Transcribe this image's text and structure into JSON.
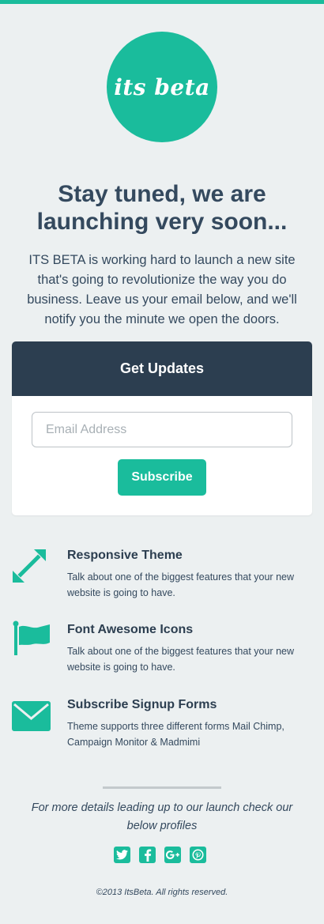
{
  "logo": {
    "text": "its beta"
  },
  "headline": "Stay tuned, we are launching very soon...",
  "intro": "ITS BETA is working hard to launch a new site that's going to revolutionize the way you do business. Leave us your email below, and we'll notify you the minute we open the doors.",
  "signup": {
    "header": "Get Updates",
    "email_placeholder": "Email Address",
    "subscribe_label": "Subscribe"
  },
  "features": [
    {
      "icon": "expand-arrows-icon",
      "title": "Responsive Theme",
      "desc": "Talk about one of the biggest features that your new website is going to have."
    },
    {
      "icon": "flag-icon",
      "title": "Font Awesome Icons",
      "desc": "Talk about one of the biggest features that your new website is going to have."
    },
    {
      "icon": "envelope-icon",
      "title": "Subscribe Signup Forms",
      "desc": "Theme supports three different forms Mail Chimp, Campaign Monitor & Madmimi"
    }
  ],
  "outro": "For more details leading up to our launch check our below profiles",
  "social": [
    {
      "icon": "twitter-icon"
    },
    {
      "icon": "facebook-icon"
    },
    {
      "icon": "google-plus-icon"
    },
    {
      "icon": "pinterest-icon"
    }
  ],
  "copyright": "©2013 ItsBeta. All rights reserved.",
  "colors": {
    "accent": "#1abc9c",
    "dark": "#2c3e50",
    "background": "#ecf0f1"
  }
}
